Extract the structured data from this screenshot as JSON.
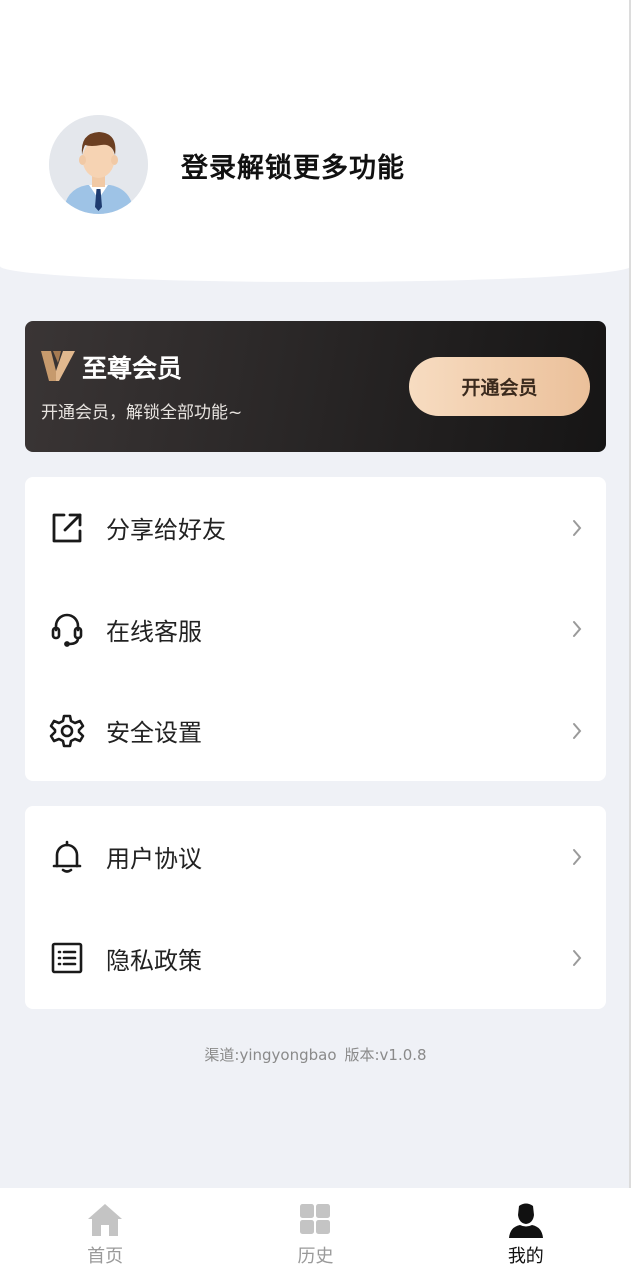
{
  "profile": {
    "login_prompt": "登录解锁更多功能",
    "avatar_icon": "male-avatar"
  },
  "vip": {
    "title": "至尊会员",
    "subtitle": "开通会员，解锁全部功能~",
    "button_label": "开通会员",
    "logo_icon": "v-logo-icon",
    "button_gradient": [
      "#f7dcc1",
      "#ebc09a"
    ]
  },
  "menu_group1": [
    {
      "label": "分享给好友",
      "icon": "share-icon"
    },
    {
      "label": "在线客服",
      "icon": "headset-icon"
    },
    {
      "label": "安全设置",
      "icon": "gear-icon"
    }
  ],
  "menu_group2": [
    {
      "label": "用户协议",
      "icon": "bell-icon"
    },
    {
      "label": "隐私政策",
      "icon": "list-icon"
    }
  ],
  "footer": {
    "channel": "渠道:yingyongbao",
    "version": "版本:v1.0.8"
  },
  "tabs": [
    {
      "label": "首页",
      "icon": "home-icon",
      "active": false
    },
    {
      "label": "历史",
      "icon": "grid-icon",
      "active": false
    },
    {
      "label": "我的",
      "icon": "person-icon",
      "active": true
    }
  ]
}
